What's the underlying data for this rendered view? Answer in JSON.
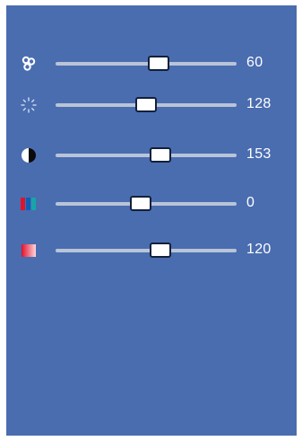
{
  "sliders": [
    {
      "id": "antiflicker",
      "icon": "fan-icon",
      "value_text": "60",
      "level": 0.57
    },
    {
      "id": "brightness",
      "icon": "sun-rays-icon",
      "value_text": "128",
      "level": 0.5
    },
    {
      "id": "contrast",
      "icon": "contrast-half-circle-icon",
      "value_text": "153",
      "level": 0.58
    },
    {
      "id": "hue",
      "icon": "color-bars-icon",
      "value_text": "0",
      "level": 0.47
    },
    {
      "id": "saturation",
      "icon": "red-gradient-icon",
      "value_text": "120",
      "level": 0.58
    }
  ],
  "colors": {
    "panel": "#4a6db0",
    "track": "#b9c4d8",
    "thumb_fill": "#ffffff",
    "thumb_border": "#12203a",
    "text": "#ffffff"
  }
}
